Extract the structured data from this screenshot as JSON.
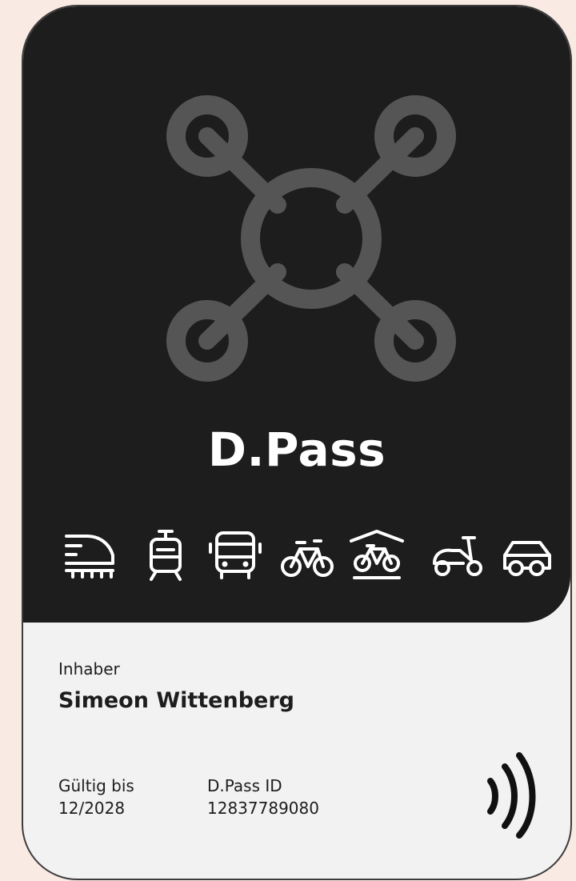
{
  "card": {
    "brand": "D.Pass",
    "holder_label": "Inhaber",
    "holder_name": "Simeon Wittenberg",
    "valid_label": "Gültig bis",
    "valid_value": "12/2028",
    "id_label": "D.Pass ID",
    "id_value": "12837789080"
  },
  "transport_modes": [
    {
      "icon": "high-speed-train-icon"
    },
    {
      "icon": "tram-icon"
    },
    {
      "icon": "bus-icon"
    },
    {
      "icon": "bike-icon"
    },
    {
      "icon": "bike-sharing-station-icon"
    },
    {
      "icon": "e-scooter-icon"
    },
    {
      "icon": "car-icon"
    }
  ],
  "colors": {
    "card_dark": "#1D1D1D",
    "card_light": "#F2F2F2",
    "page_background": "#F9EBE4",
    "logo_grey": "#555555",
    "text_dark": "#1D1D1D"
  }
}
